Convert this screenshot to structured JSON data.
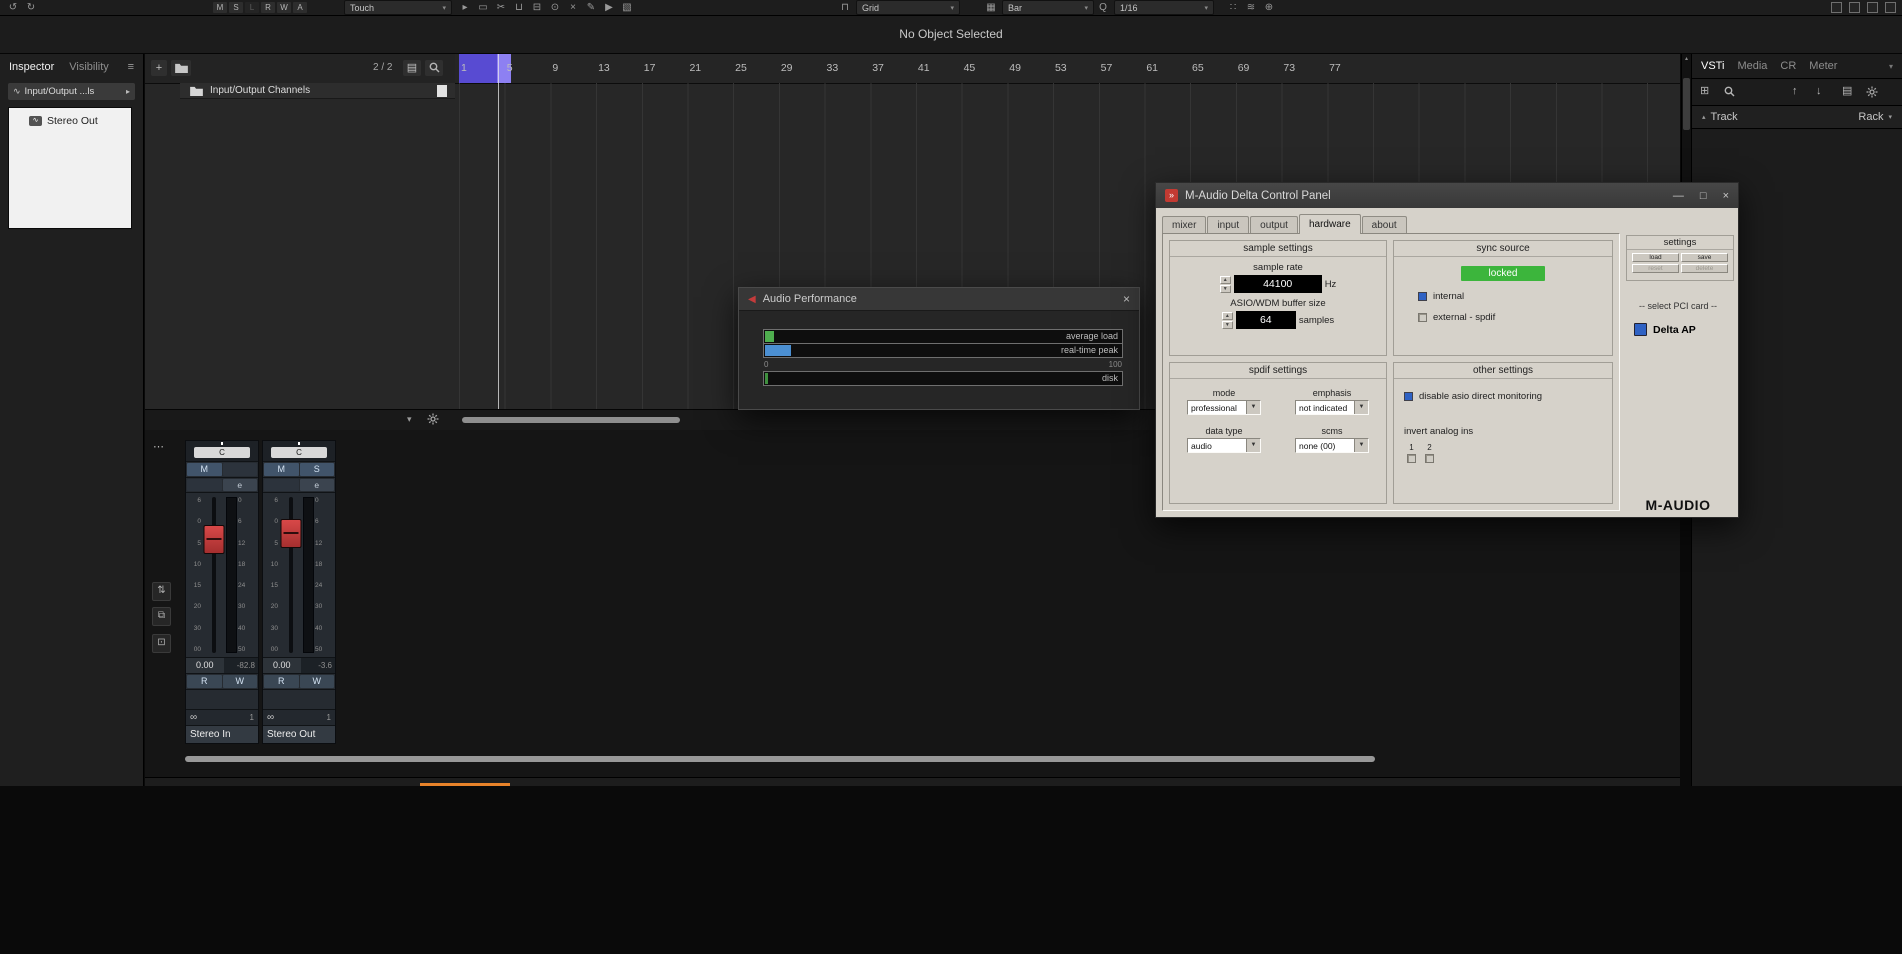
{
  "icons": {
    "undo": "↺",
    "redo": "↻",
    "chevron_down": "▾",
    "chevron_up": "▴",
    "chevron_right": "▸",
    "menu": "≡",
    "dots": "⋯",
    "plus": "+",
    "close": "×",
    "minimize": "—",
    "maximize": "□",
    "select_tool": "▸",
    "range_tool": "▭",
    "split_tool": "✂",
    "glue_tool": "⊔",
    "erase_tool": "⊟",
    "zoom_tool": "⊙",
    "mute_tool": "×",
    "draw_tool": "✎",
    "play_tool": "▶",
    "color_tool": "▧",
    "snap": "⊓",
    "grid_box": "▦",
    "quantize_q": "Q",
    "misc_a": "∷",
    "misc_b": "≋",
    "misc_c": "⊕",
    "list": "▤",
    "preset": "▤",
    "arrow_up": "↑",
    "arrow_down": "↓",
    "waveform": "∿",
    "stereo": "∞",
    "spin_up": "▲",
    "spin_down": "▼",
    "steinberg": "◀",
    "maudio_badge": "»",
    "add_rack": "⊞"
  },
  "toolbar": {
    "automation_letters": [
      "M",
      "S",
      "L",
      "R",
      "W",
      "A"
    ],
    "touch": "Touch",
    "grid": "Grid",
    "bar": "Bar",
    "quantize": "1/16"
  },
  "status_bar": {
    "text": "No Object Selected"
  },
  "left_panel": {
    "tabs": [
      "Inspector",
      "Visibility"
    ],
    "io_button": "Input/Output ...ls",
    "track_name": "Stereo Out"
  },
  "track_area": {
    "counter": "2 / 2",
    "track_label": "Input/Output Channels",
    "ruler_ticks": [
      "1",
      "5",
      "9",
      "13",
      "17",
      "21",
      "25",
      "29",
      "33",
      "37",
      "41",
      "45",
      "49",
      "53",
      "57",
      "61",
      "65",
      "69",
      "73",
      "77"
    ]
  },
  "right_panel": {
    "tabs": [
      "VSTi",
      "Media",
      "CR",
      "Meter"
    ],
    "track_label": "Track",
    "rack_label": "Rack"
  },
  "mixer": {
    "fader_scale": [
      "6",
      "0",
      "5",
      "10",
      "15",
      "20",
      "30",
      "00"
    ],
    "meter_scale": [
      "0",
      "6",
      "12",
      "18",
      "24",
      "30",
      "40",
      "50"
    ],
    "channels": [
      {
        "pan": "C",
        "mute": "M",
        "solo": "",
        "edit": "e",
        "value": "0.00",
        "peak": "-82.8",
        "read": "R",
        "write": "W",
        "out_num": "1",
        "name": "Stereo In"
      },
      {
        "pan": "C",
        "mute": "M",
        "solo": "S",
        "edit": "e",
        "value": "0.00",
        "peak": "-3.6",
        "read": "R",
        "write": "W",
        "out_num": "1",
        "name": "Stereo Out"
      }
    ]
  },
  "audio_performance": {
    "title": "Audio Performance",
    "meter1_label": "average load",
    "meter2_label": "real-time peak",
    "meter3_label": "disk",
    "scale_min": "0",
    "scale_max": "100"
  },
  "delta_panel": {
    "title": "M-Audio Delta Control Panel",
    "tabs": [
      "mixer",
      "input",
      "output",
      "hardware",
      "about"
    ],
    "sample_settings": {
      "heading": "sample settings",
      "rate_label": "sample rate",
      "rate_value": "44100",
      "rate_unit": "Hz",
      "buffer_label": "ASIO/WDM buffer size",
      "buffer_value": "64",
      "buffer_unit": "samples"
    },
    "sync_source": {
      "heading": "sync source",
      "status": "locked",
      "internal": "internal",
      "external": "external - spdif"
    },
    "spdif": {
      "heading": "spdif settings",
      "mode_label": "mode",
      "mode_value": "professional",
      "emphasis_label": "emphasis",
      "emphasis_value": "not indicated",
      "datatype_label": "data type",
      "datatype_value": "audio",
      "scms_label": "scms",
      "scms_value": "none (00)"
    },
    "other": {
      "heading": "other settings",
      "monitoring_label": "disable asio direct monitoring",
      "invert_label": "invert analog ins",
      "ch1": "1",
      "ch2": "2"
    },
    "settings_box": {
      "heading": "settings",
      "load": "load",
      "save": "save",
      "reset": "reset",
      "delete": "delete"
    },
    "pci_label": "-- select PCI card --",
    "pci_card": "Delta AP",
    "logo": "M-AUDIO"
  }
}
